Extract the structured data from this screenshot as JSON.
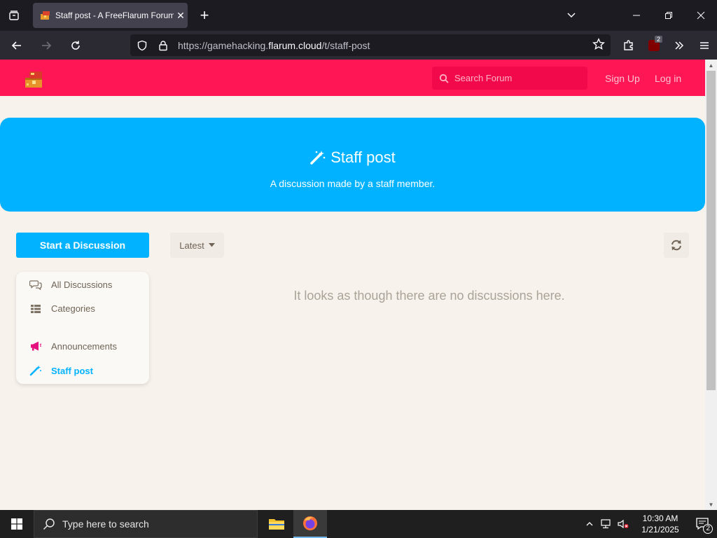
{
  "browser": {
    "tab_title": "Staff post - A FreeFlarum Forum",
    "url_prefix": "https://gamehacking.",
    "url_domain": "flarum.cloud",
    "url_path": "/t/staff-post",
    "extension_badge": "2"
  },
  "forum": {
    "search_placeholder": "Search Forum",
    "signup_label": "Sign Up",
    "login_label": "Log in",
    "accent_color": "#ff1654",
    "tag_color": "#00b2ff"
  },
  "hero": {
    "title": "Staff post",
    "description": "A discussion made by a staff member."
  },
  "sidebar": {
    "start_label": "Start a Discussion",
    "items": [
      {
        "label": "All Discussions",
        "icon": "comments-icon"
      },
      {
        "label": "Categories",
        "icon": "categories-icon"
      },
      {
        "label": "Announcements",
        "icon": "megaphone-icon"
      },
      {
        "label": "Staff post",
        "icon": "magic-wand-icon"
      }
    ]
  },
  "toolbar": {
    "sort_label": "Latest"
  },
  "main": {
    "empty_text": "It looks as though there are no discussions here."
  },
  "taskbar": {
    "search_placeholder": "Type here to search",
    "time": "10:30 AM",
    "date": "1/21/2025",
    "notification_count": "2"
  }
}
